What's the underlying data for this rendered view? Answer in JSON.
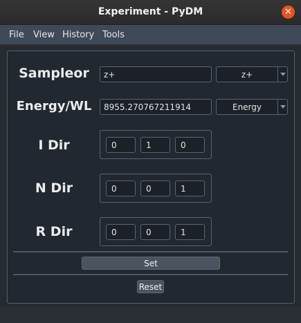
{
  "window": {
    "title": "Experiment - PyDM",
    "close_symbol": "✕"
  },
  "menubar": {
    "items": [
      "File",
      "View",
      "History",
      "Tools"
    ]
  },
  "sampleor": {
    "label": "Sampleor",
    "value": "z+",
    "combo_value": "z+"
  },
  "energy": {
    "label": "Energy/WL",
    "value": "8955.270767211914",
    "combo_value": "Energy"
  },
  "i_dir": {
    "label": "I Dir",
    "values": [
      "0",
      "1",
      "0"
    ]
  },
  "n_dir": {
    "label": "N Dir",
    "values": [
      "0",
      "0",
      "1"
    ]
  },
  "r_dir": {
    "label": "R Dir",
    "values": [
      "0",
      "0",
      "1"
    ]
  },
  "buttons": {
    "set": "Set",
    "reset": "Reset"
  },
  "colors": {
    "close_accent": "#e95420",
    "menubar": "#3e4a58",
    "panel": "#212830"
  }
}
